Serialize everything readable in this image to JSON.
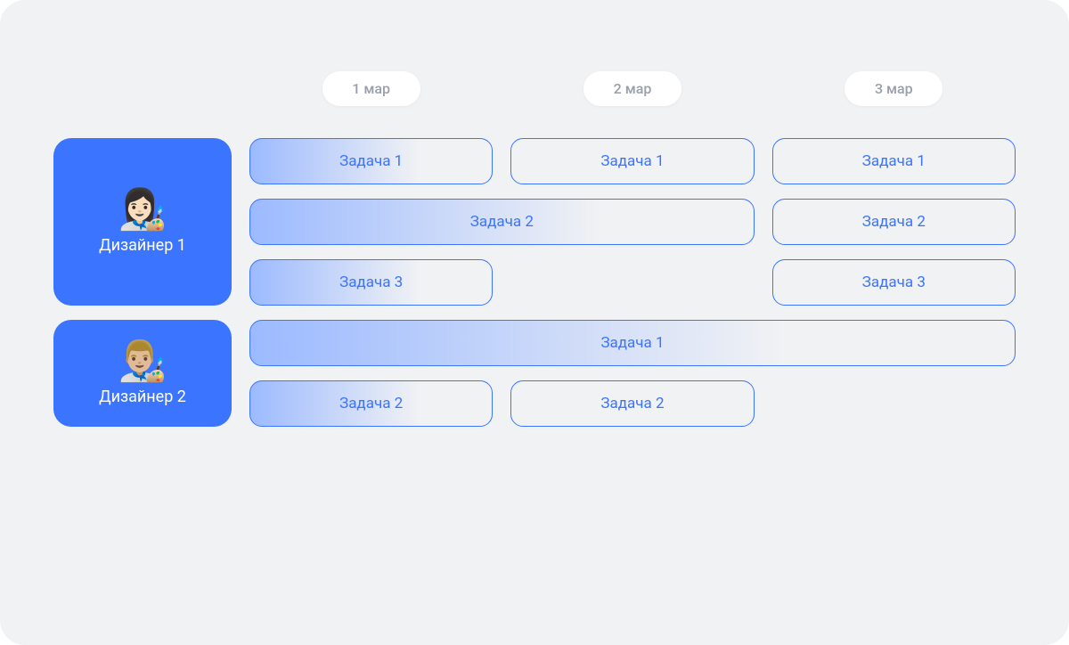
{
  "dates": [
    "1 мар",
    "2 мар",
    "3 мар"
  ],
  "designers": [
    {
      "emoji": "👩🏻‍🎨",
      "name": "Дизайнер 1"
    },
    {
      "emoji": "👨🏼‍🎨",
      "name": "Дизайнер 2"
    }
  ],
  "tasks": {
    "d1": {
      "r1": {
        "c1": "Задача 1",
        "c2": "Задача 1",
        "c3": "Задача 1"
      },
      "r2": {
        "span2": "Задача 2",
        "c3": "Задача 2"
      },
      "r3": {
        "c1": "Задача 3",
        "c3": "Задача 3"
      }
    },
    "d2": {
      "r1": {
        "span3": "Задача 1"
      },
      "r2": {
        "c1": "Задача 2",
        "c2": "Задача 2"
      }
    }
  }
}
